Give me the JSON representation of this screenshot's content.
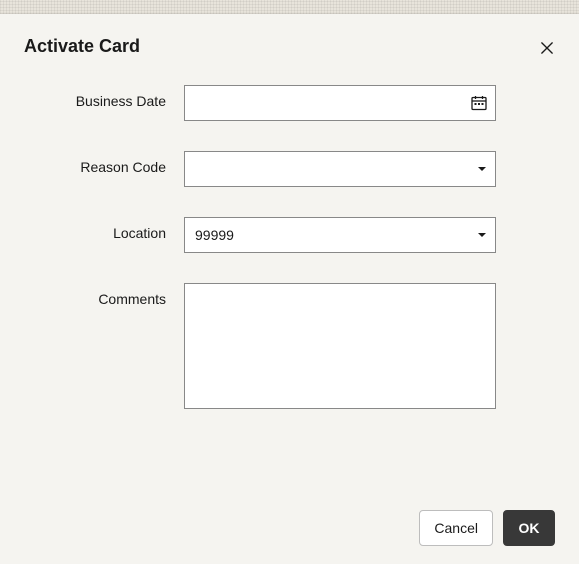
{
  "dialog": {
    "title": "Activate Card",
    "fields": {
      "business_date": {
        "label": "Business Date",
        "value": ""
      },
      "reason_code": {
        "label": "Reason Code",
        "value": ""
      },
      "location": {
        "label": "Location",
        "value": "99999"
      },
      "comments": {
        "label": "Comments",
        "value": ""
      }
    },
    "buttons": {
      "cancel": "Cancel",
      "ok": "OK"
    }
  }
}
